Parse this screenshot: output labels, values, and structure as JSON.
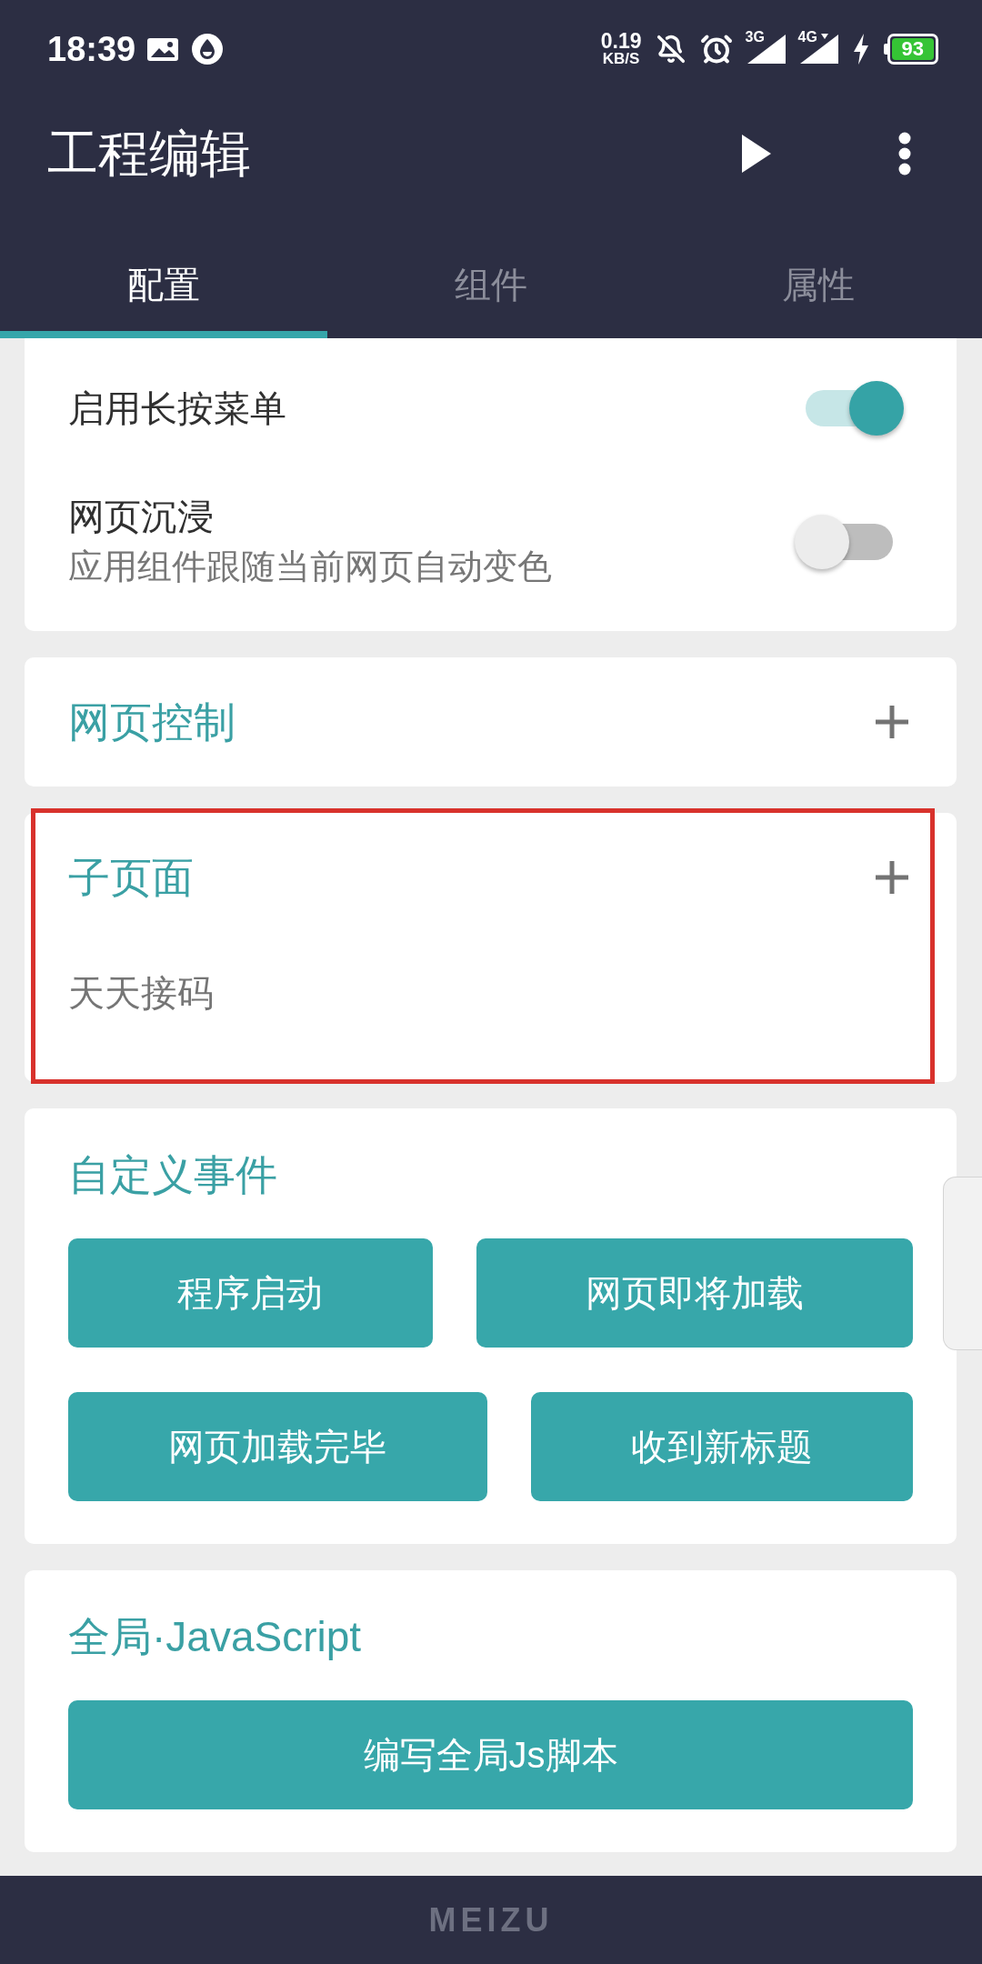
{
  "status_bar": {
    "time": "18:39",
    "speed_value": "0.19",
    "speed_unit": "KB/S",
    "networks": [
      {
        "type": "3G",
        "arrow": false
      },
      {
        "type": "4G",
        "arrow": true
      }
    ],
    "battery": "93"
  },
  "app_bar": {
    "title": "工程编辑"
  },
  "tabs": [
    {
      "label": "配置",
      "selected": true
    },
    {
      "label": "组件",
      "selected": false
    },
    {
      "label": "属性",
      "selected": false
    }
  ],
  "settings": [
    {
      "label": "启用长按菜单",
      "on": true
    },
    {
      "label": "网页沉浸",
      "description": "应用组件跟随当前网页自动变色",
      "on": false
    }
  ],
  "sections": [
    {
      "kind": "expandable",
      "title": "网页控制",
      "highlighted": false
    },
    {
      "kind": "expandable",
      "title": "子页面",
      "items": [
        "天天接码"
      ],
      "highlighted": true
    },
    {
      "kind": "buttons",
      "title": "自定义事件",
      "button_rows": [
        [
          "程序启动",
          "网页即将加载"
        ],
        [
          "网页加载完毕",
          "收到新标题"
        ]
      ],
      "highlighted": false
    },
    {
      "kind": "buttons",
      "title": "全局·JavaScript",
      "button_rows": [
        [
          "编写全局Js脚本"
        ]
      ],
      "highlighted": false
    }
  ],
  "nav_bar": {
    "brand": "MEIZU"
  }
}
